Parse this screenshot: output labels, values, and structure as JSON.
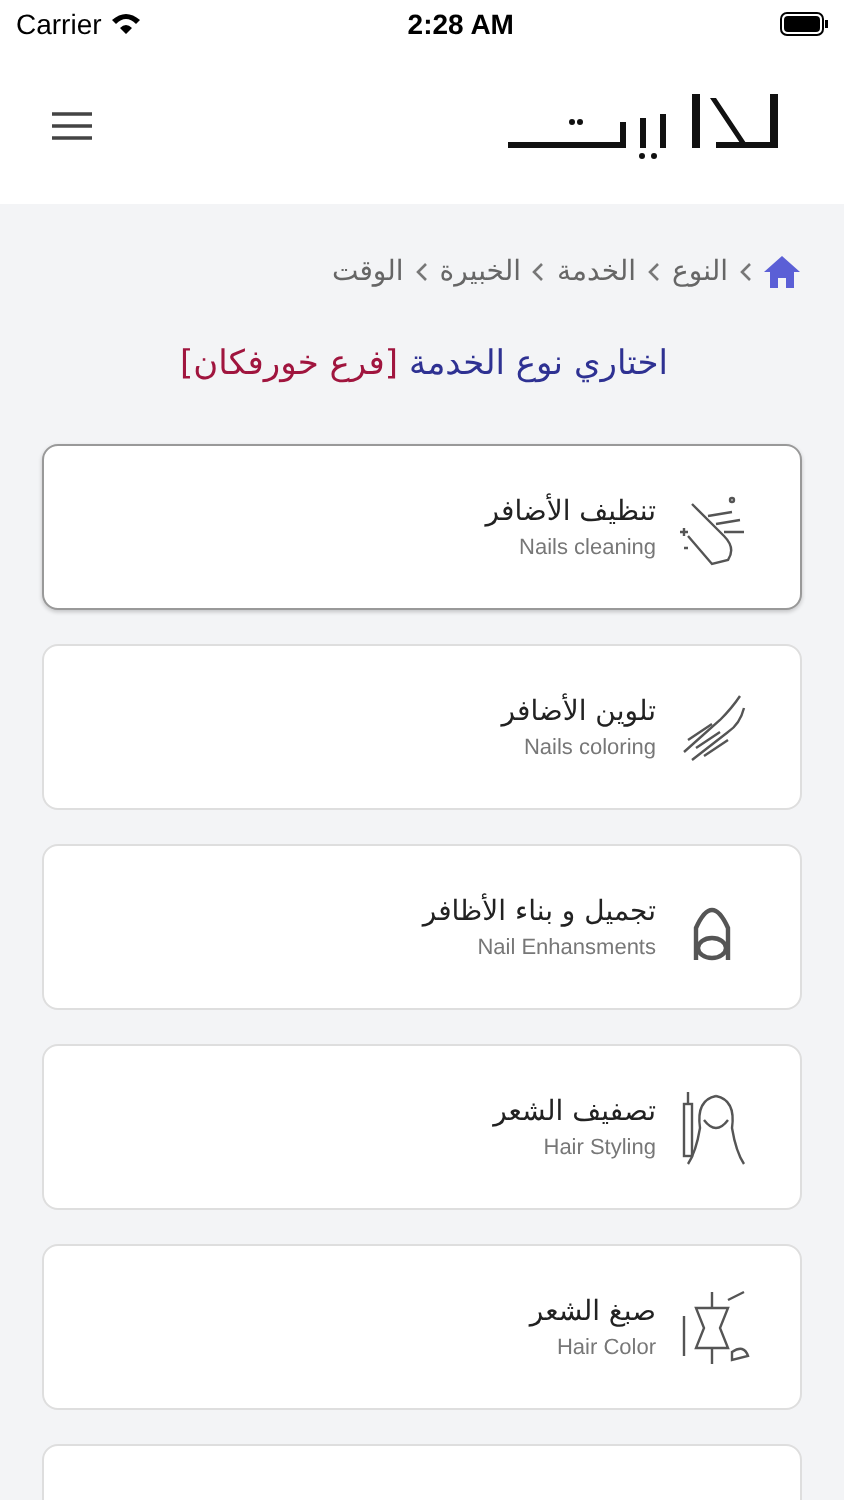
{
  "status_bar": {
    "carrier": "Carrier",
    "time": "2:28 AM"
  },
  "breadcrumb": [
    "النوع",
    "الخدمة",
    "الخبيرة",
    "الوقت"
  ],
  "heading": {
    "text": "اختاري نوع الخدمة",
    "branch": "[فرع خورفكان]"
  },
  "services": [
    {
      "title": "تنظيف الأضافر",
      "subtitle": "Nails cleaning",
      "selected": true
    },
    {
      "title": "تلوين الأضافر",
      "subtitle": "Nails coloring",
      "selected": false
    },
    {
      "title": "تجميل و بناء الأظافر",
      "subtitle": "Nail Enhansments",
      "selected": false
    },
    {
      "title": "تصفيف الشعر",
      "subtitle": "Hair Styling",
      "selected": false
    },
    {
      "title": "صبغ الشعر",
      "subtitle": "Hair Color",
      "selected": false
    },
    {
      "selected": false
    }
  ]
}
